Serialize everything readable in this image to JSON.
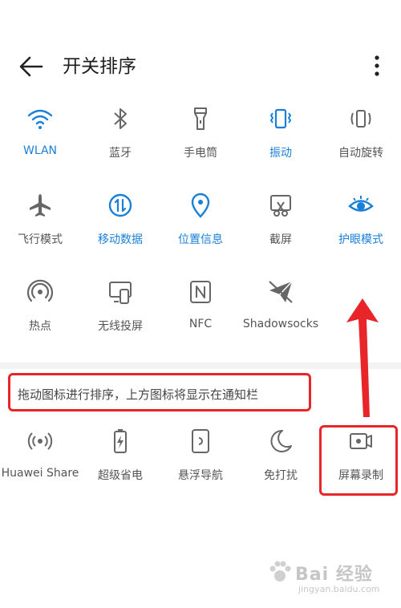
{
  "header": {
    "title": "开关排序"
  },
  "active_tiles": [
    {
      "label": "WLAN",
      "icon": "wifi-icon",
      "on": true
    },
    {
      "label": "蓝牙",
      "icon": "bluetooth-icon",
      "on": false
    },
    {
      "label": "手电筒",
      "icon": "flashlight-icon",
      "on": false
    },
    {
      "label": "振动",
      "icon": "vibrate-icon",
      "on": true
    },
    {
      "label": "自动旋转",
      "icon": "auto-rotate-icon",
      "on": false
    },
    {
      "label": "飞行模式",
      "icon": "airplane-icon",
      "on": false
    },
    {
      "label": "移动数据",
      "icon": "mobile-data-icon",
      "on": true
    },
    {
      "label": "位置信息",
      "icon": "location-icon",
      "on": true
    },
    {
      "label": "截屏",
      "icon": "screenshot-icon",
      "on": false
    },
    {
      "label": "护眼模式",
      "icon": "eye-comfort-icon",
      "on": true
    },
    {
      "label": "热点",
      "icon": "hotspot-icon",
      "on": false
    },
    {
      "label": "无线投屏",
      "icon": "wireless-projection-icon",
      "on": false
    },
    {
      "label": "NFC",
      "icon": "nfc-icon",
      "on": false
    },
    {
      "label": "Shadowsocks",
      "icon": "shadowsocks-icon",
      "on": false
    }
  ],
  "hint": "拖动图标进行排序，上方图标将显示在通知栏",
  "inactive_tiles": [
    {
      "label": "Huawei Share",
      "icon": "huawei-share-icon"
    },
    {
      "label": "超级省电",
      "icon": "battery-saver-icon"
    },
    {
      "label": "悬浮导航",
      "icon": "floating-dock-icon"
    },
    {
      "label": "免打扰",
      "icon": "do-not-disturb-icon"
    },
    {
      "label": "屏幕录制",
      "icon": "screen-record-icon"
    }
  ],
  "watermark": {
    "main": "Bai 经验",
    "sub": "jingyan.baidu.com"
  },
  "colors": {
    "accent": "#1a7fd8",
    "inactive_icon": "#666666",
    "annotation_red": "#e8262a"
  }
}
